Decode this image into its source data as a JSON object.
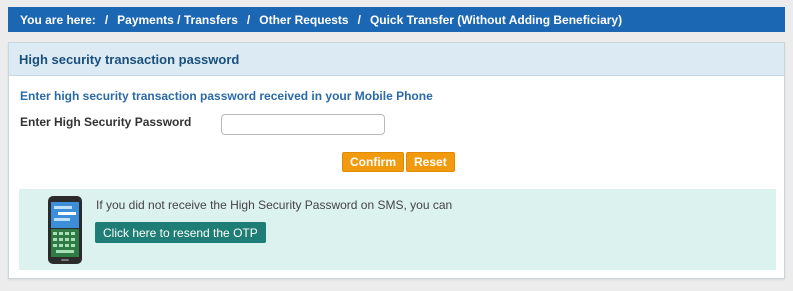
{
  "breadcrumb": {
    "prefix": "You are here:",
    "items": [
      "Payments / Transfers",
      "Other Requests",
      "Quick Transfer (Without Adding Beneficiary)"
    ],
    "separator": "/"
  },
  "section": {
    "title": "High security transaction password",
    "intro": "Enter high security transaction password received in your Mobile Phone"
  },
  "form": {
    "password_label": "Enter High Security Password",
    "password_value": "",
    "confirm_label": "Confirm",
    "reset_label": "Reset"
  },
  "otp": {
    "message": "If you did not receive the High Security Password on SMS, you can",
    "resend_label": "Click here to resend the OTP",
    "icon": "mobile-phone-icon"
  },
  "colors": {
    "breadcrumb_bg": "#1c67b3",
    "section_header_bg": "#dcebf3",
    "button_orange": "#f29a0d",
    "otp_panel_bg": "#dcf2ee",
    "otp_button": "#1e7d74"
  }
}
